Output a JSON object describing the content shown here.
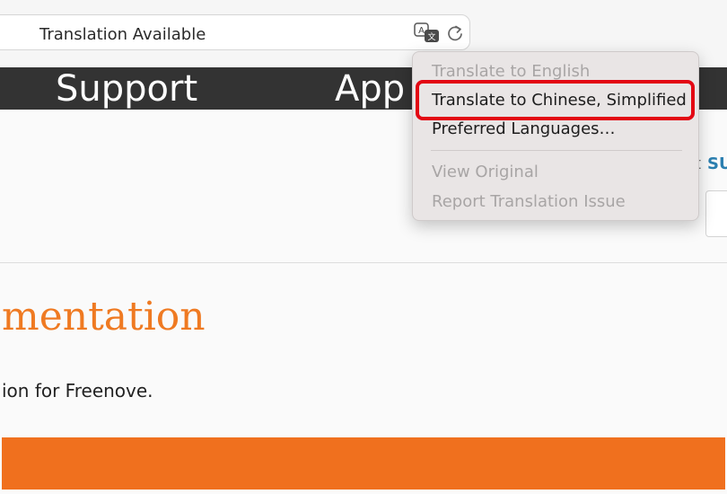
{
  "toolbar": {
    "address_text": "Translation Available",
    "translate_icon": "translate-icon",
    "reload_icon": "reload-icon"
  },
  "site_nav": {
    "items": [
      "Support",
      "App"
    ]
  },
  "translate_menu": {
    "items": [
      {
        "label": "Translate to English",
        "enabled": false
      },
      {
        "label": "Translate to Chinese, Simplified",
        "enabled": true,
        "highlighted": true
      },
      {
        "label": "Preferred Languages…",
        "enabled": true
      },
      {
        "label": "View Original",
        "enabled": false
      },
      {
        "label": "Report Translation Issue",
        "enabled": false
      }
    ]
  },
  "page": {
    "right_stub_text": "SU",
    "right_stub_arrow": "t",
    "heading_fragment": "mentation",
    "subtitle_fragment": "ion for Freenove."
  },
  "colors": {
    "nav_bg": "#333333",
    "heading": "#ef7a22",
    "band": "#f0701e",
    "highlight": "#e30613",
    "link": "#2b7fb0"
  }
}
